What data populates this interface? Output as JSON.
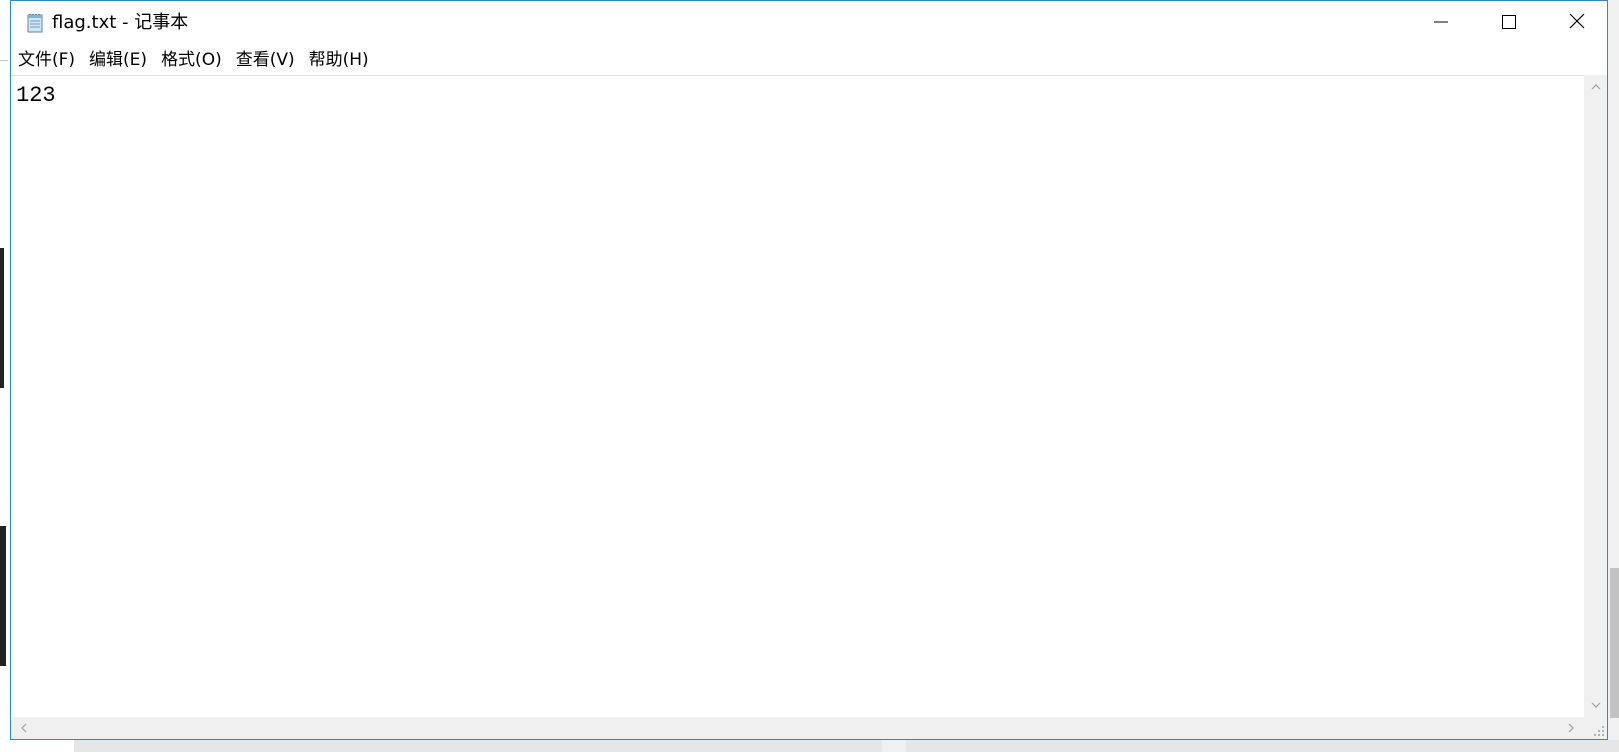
{
  "window": {
    "title": "flag.txt - 记事本",
    "app_icon": "notepad-icon",
    "accent_color": "#2b88d8",
    "controls": {
      "minimize_icon": "minimize-icon",
      "maximize_icon": "maximize-icon",
      "close_icon": "close-icon"
    }
  },
  "menubar": {
    "items": [
      {
        "label": "文件(F)"
      },
      {
        "label": "编辑(E)"
      },
      {
        "label": "格式(O)"
      },
      {
        "label": "查看(V)"
      },
      {
        "label": "帮助(H)"
      }
    ]
  },
  "editor": {
    "content": "123"
  },
  "scrollbars": {
    "vertical": {
      "up_icon": "chevron-up-icon",
      "down_icon": "chevron-down-icon"
    },
    "horizontal": {
      "left_icon": "chevron-left-icon",
      "right_icon": "chevron-right-icon"
    }
  }
}
